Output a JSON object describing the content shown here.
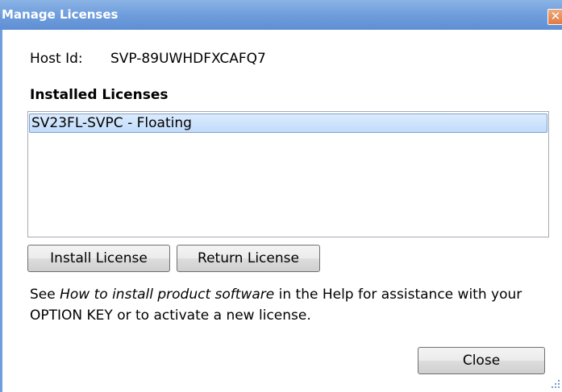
{
  "window": {
    "title": "Manage Licenses",
    "close_glyph": "✕"
  },
  "host": {
    "label": "Host Id:",
    "value": "SVP-89UWHDFXCAFQ7"
  },
  "installed": {
    "heading": "Installed Licenses",
    "items": [
      {
        "label": "SV23FL-SVPC - Floating",
        "selected": true
      }
    ]
  },
  "buttons": {
    "install": "Install License",
    "return": "Return License",
    "close": "Close"
  },
  "help": {
    "prefix": "See ",
    "link_text": "How to install product software",
    "suffix": " in the Help for assistance with your OPTION KEY or to activate a new license."
  },
  "colors": {
    "titlebar": "#6f9edc",
    "selection": "#c1dcfc",
    "close_accent": "#e07a45"
  },
  "icons": {
    "close": "close-icon",
    "resize": "resize-grip-icon"
  }
}
